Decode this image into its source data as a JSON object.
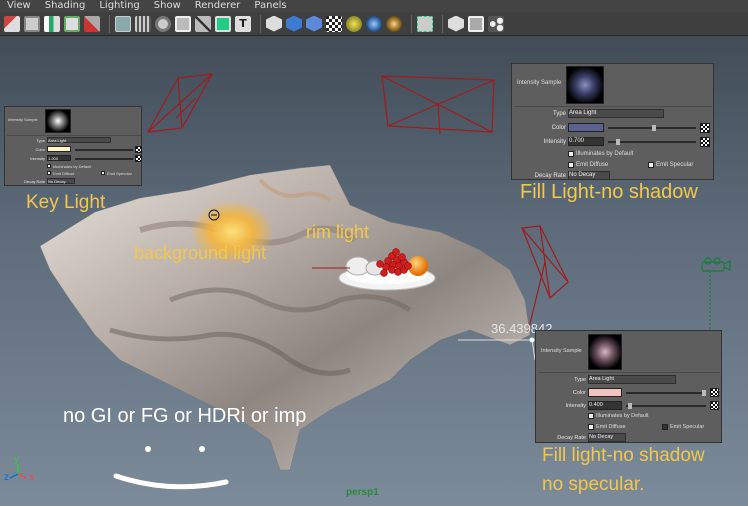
{
  "menubar": {
    "items": [
      "View",
      "Shading",
      "Lighting",
      "Show",
      "Renderer",
      "Panels"
    ]
  },
  "toolbar": {
    "icons": [
      "select-camera-icon",
      "camera-attributes-icon",
      "bookmark-icon",
      "image-plane-icon",
      "wireframe-on-shaded-icon",
      "isolate-icon",
      "grid-icon",
      "film-gate-icon",
      "resolution-gate-icon",
      "safe-action-icon",
      "gate-mask-icon",
      "field-chart-icon",
      "texture-icon",
      "wireframe-icon",
      "smooth-shade-icon",
      "bounding-box-icon",
      "checker-icon",
      "default-light-icon",
      "all-lights-icon",
      "shadows-icon",
      "xray-icon",
      "isolate-select-icon",
      "camera-mode-icon",
      "node-editor-icon"
    ]
  },
  "viewport": {
    "camera_label": "persp1",
    "measure_value": "36.439842",
    "axis": {
      "x": "x",
      "y": "y",
      "z": "z"
    }
  },
  "panel_key": {
    "swatch_label": "Intensity Sample",
    "type_label": "Type",
    "type_value": "Area Light",
    "color_label": "Color",
    "color_hex": "#fff6c8",
    "intensity_label": "Intensity",
    "intensity_value": "1.200",
    "illum_label": "Illuminates by Default",
    "diffuse_label": "Emit Diffuse",
    "specular_label": "Emit Specular",
    "decay_label": "Decay Rate",
    "decay_value": "No Decay"
  },
  "panel_fill1": {
    "swatch_label": "Intensity Sample",
    "type_label": "Type",
    "type_value": "Area Light",
    "color_label": "Color",
    "color_hex": "#5b6190",
    "intensity_label": "Intensity",
    "intensity_value": "0.700",
    "illum_label": "Illuminates by Default",
    "diffuse_label": "Emit Diffuse",
    "specular_label": "Emit Specular",
    "decay_label": "Decay Rate",
    "decay_value": "No Decay"
  },
  "panel_fill2": {
    "swatch_label": "Intensity Sample",
    "type_label": "Type",
    "type_value": "Area Light",
    "color_label": "Color",
    "color_hex": "#f2c2c2",
    "intensity_label": "Intensity",
    "intensity_value": "0.400",
    "illum_label": "Illuminates by Default",
    "diffuse_label": "Emit Diffuse",
    "specular_label": "Emit Specular",
    "decay_label": "Decay Rate",
    "decay_value": "No Decay"
  },
  "annotations": {
    "key_light": "Key Light",
    "background_light": "background light",
    "rim_light": "rim light",
    "fill_light_1": "Fill Light-no shadow",
    "fill_light_2_line1": "Fill light-no shadow",
    "fill_light_2_line2": "no specular.",
    "note": "no GI or FG or HDRi or imp"
  },
  "colors": {
    "annotation": "#f2c84b",
    "light_wire": "#a01c1c",
    "panel_bg": "#5e5e5e",
    "menubar_bg": "#444444"
  }
}
